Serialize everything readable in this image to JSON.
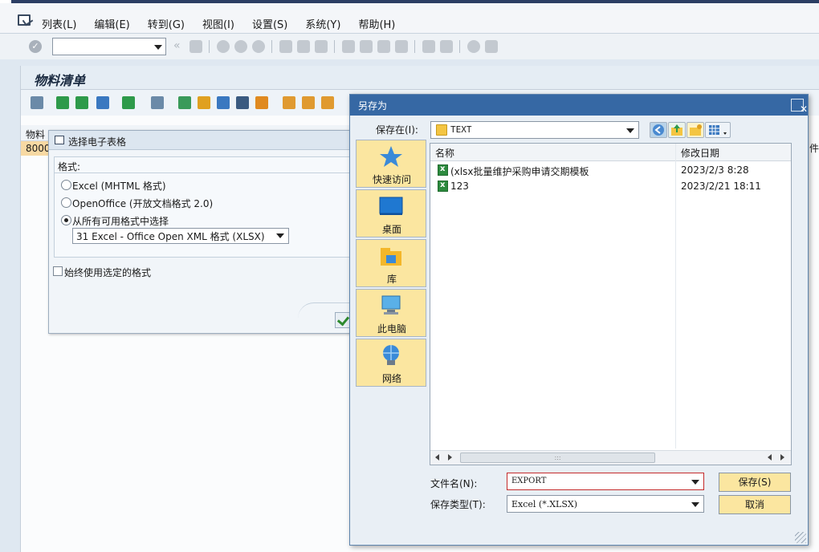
{
  "menu": {
    "items": [
      "列表(L)",
      "编辑(E)",
      "转到(G)",
      "视图(I)",
      "设置(S)",
      "系统(Y)",
      "帮助(H)"
    ]
  },
  "screen": {
    "title": "物料清单",
    "grid_header": "物料",
    "grid_value": "8000",
    "right_tail": "件"
  },
  "spreadsheet_dialog": {
    "title": "选择电子表格",
    "format_label": "格式:",
    "options": [
      {
        "label": "Excel (MHTML 格式)",
        "selected": false
      },
      {
        "label": "OpenOffice (开放文档格式 2.0)",
        "selected": false
      },
      {
        "label": "从所有可用格式中选择",
        "selected": true
      }
    ],
    "format_select": "31 Excel - Office Open XML 格式 (XLSX)",
    "always_use_label": "始终使用选定的格式",
    "always_use_checked": false
  },
  "save_dialog": {
    "title": "另存为",
    "close_glyph": "✕",
    "save_in_label": "保存在(I):",
    "save_in_value": "TEXT",
    "places": [
      {
        "label": "快速访问",
        "icon": "star-icon"
      },
      {
        "label": "桌面",
        "icon": "desktop-icon"
      },
      {
        "label": "库",
        "icon": "library-icon"
      },
      {
        "label": "此电脑",
        "icon": "computer-icon"
      },
      {
        "label": "网络",
        "icon": "network-icon"
      }
    ],
    "columns": {
      "name": "名称",
      "date": "修改日期"
    },
    "files": [
      {
        "name": "(xlsx批量维护采购申请交期模板",
        "date": "2023/2/3 8:28"
      },
      {
        "name": "123",
        "date": "2023/2/21 18:11"
      }
    ],
    "scroll_grip": ":::",
    "filename_label": "文件名(N):",
    "filename_value": "EXPORT",
    "filetype_label": "保存类型(T):",
    "filetype_value": "Excel (*.XLSX)",
    "save_button": "保存(S)",
    "cancel_button": "取消"
  },
  "colors": {
    "title_blue": "#3668a4",
    "button_yellow": "#fbe6a0",
    "selected_row": "#f7d9a3"
  }
}
